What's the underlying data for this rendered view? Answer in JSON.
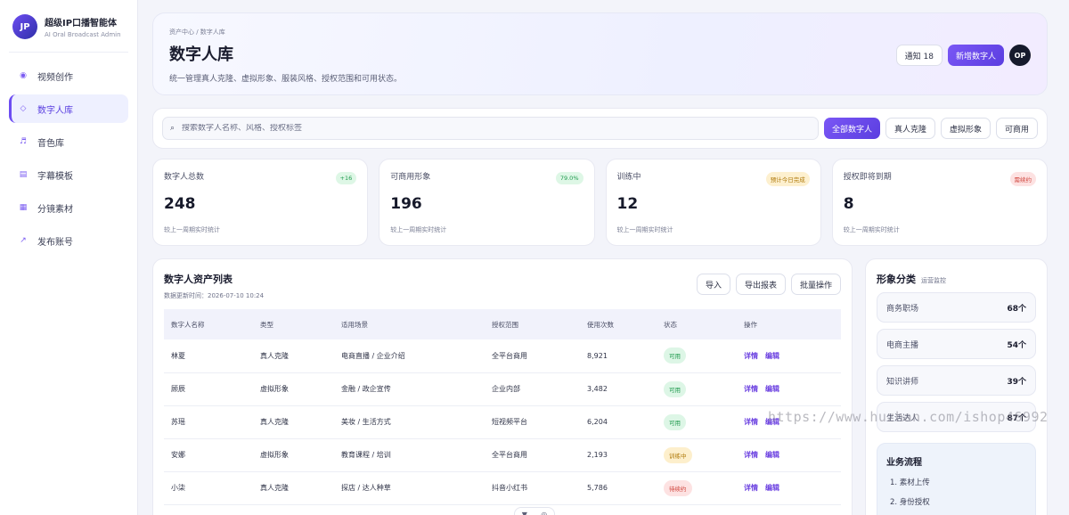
{
  "brand": {
    "logo": "JP",
    "name": "超级IP口播智能体",
    "subtitle": "AI Oral Broadcast Admin"
  },
  "nav": [
    {
      "label": "视频创作",
      "icon": "◉",
      "active": false
    },
    {
      "label": "数字人库",
      "icon": "◇",
      "active": true
    },
    {
      "label": "音色库",
      "icon": "♬",
      "active": false
    },
    {
      "label": "字幕模板",
      "icon": "▤",
      "active": false
    },
    {
      "label": "分镜素材",
      "icon": "▦",
      "active": false
    },
    {
      "label": "发布账号",
      "icon": "↗",
      "active": false
    }
  ],
  "header": {
    "breadcrumb": "资产中心 / 数字人库",
    "title": "数字人库",
    "description": "统一管理真人克隆、虚拟形象、服装风格、授权范围和可用状态。",
    "notify_label": "通知 18",
    "new_button": "新增数字人",
    "avatar": "OP"
  },
  "search": {
    "placeholder": "搜索数字人名称、风格、授权标签",
    "icon": "⌕"
  },
  "filters": [
    {
      "label": "全部数字人",
      "active": true
    },
    {
      "label": "真人克隆",
      "active": false
    },
    {
      "label": "虚拟形象",
      "active": false
    },
    {
      "label": "可商用",
      "active": false
    }
  ],
  "stats": [
    {
      "label": "数字人总数",
      "value": "248",
      "badge": "+16",
      "badge_color": "#1f9a4d",
      "sub": "较上一周期实时统计"
    },
    {
      "label": "可商用形象",
      "value": "196",
      "badge": "79.0%",
      "badge_color": "#1f9a4d",
      "sub": "较上一周期实时统计"
    },
    {
      "label": "训练中",
      "value": "12",
      "badge": "预计今日完成",
      "badge_color": "#b07a0c",
      "sub": "较上一周期实时统计"
    },
    {
      "label": "授权即将到期",
      "value": "8",
      "badge": "需续约",
      "badge_color": "#d0453d",
      "sub": "较上一周期实时统计"
    }
  ],
  "table": {
    "title": "数字人资产列表",
    "updated": "数据更新时间：2026-07-10 10:24",
    "actions": [
      "导入",
      "导出报表",
      "批量操作"
    ],
    "columns": [
      "数字人名称",
      "类型",
      "适用场景",
      "授权范围",
      "使用次数",
      "状态",
      "操作"
    ],
    "rows": [
      {
        "name": "林夏",
        "type": "真人克隆",
        "scene": "电商直播 / 企业介绍",
        "scope": "全平台商用",
        "uses": "8,921",
        "status": "可用",
        "status_color": "#1f9a4d"
      },
      {
        "name": "顾辰",
        "type": "虚拟形象",
        "scene": "金融 / 政企宣传",
        "scope": "企业内部",
        "uses": "3,482",
        "status": "可用",
        "status_color": "#1f9a4d"
      },
      {
        "name": "苏瑶",
        "type": "真人克隆",
        "scene": "美妆 / 生活方式",
        "scope": "短视频平台",
        "uses": "6,204",
        "status": "可用",
        "status_color": "#1f9a4d"
      },
      {
        "name": "安娜",
        "type": "虚拟形象",
        "scene": "教育课程 / 培训",
        "scope": "全平台商用",
        "uses": "2,193",
        "status": "训练中",
        "status_color": "#b07a0c"
      },
      {
        "name": "小柒",
        "type": "真人克隆",
        "scene": "探店 / 达人种草",
        "scope": "抖音小红书",
        "uses": "5,786",
        "status": "待续约",
        "status_color": "#d0453d"
      }
    ],
    "op_detail": "详情",
    "op_edit": "编辑",
    "pager_down": "▼",
    "pager_target": "◎"
  },
  "categories": {
    "title": "形象分类",
    "subtitle": "运营监控",
    "items": [
      {
        "name": "商务职场",
        "count": "68个"
      },
      {
        "name": "电商主播",
        "count": "54个"
      },
      {
        "name": "知识讲师",
        "count": "39个"
      },
      {
        "name": "生活达人",
        "count": "87个"
      }
    ]
  },
  "workflow": {
    "title": "业务流程",
    "steps": [
      "1. 素材上传",
      "2. 身份授权"
    ]
  },
  "watermark": "https://www.huzhan.com/ishop46992"
}
